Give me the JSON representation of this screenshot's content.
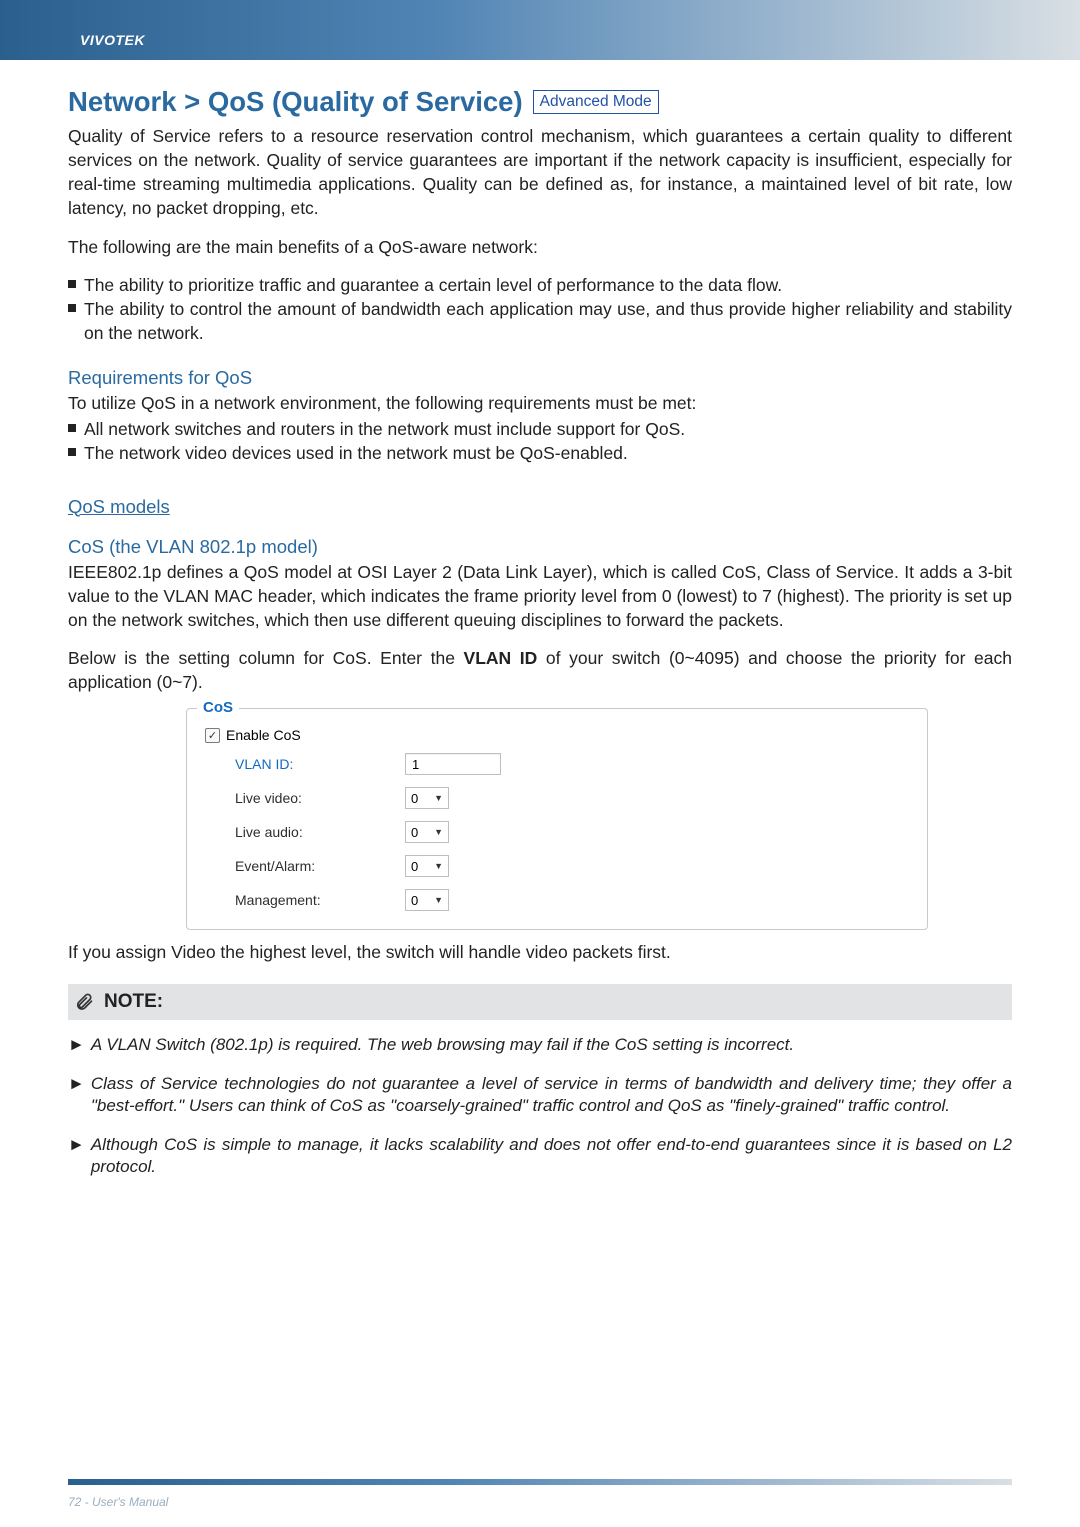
{
  "brand": "VIVOTEK",
  "title": "Network > QoS (Quality of Service)",
  "mode_badge": "Advanced Mode",
  "intro1": "Quality of Service refers to a resource reservation control mechanism, which guarantees a certain quality to different services on the network. Quality of service guarantees are important if the network capacity is insufficient, especially for real-time streaming multimedia applications. Quality can be defined as, for instance, a maintained level of bit rate, low latency, no packet dropping, etc.",
  "benefits_intro": "The following are the main benefits of a QoS-aware network:",
  "benefits": [
    "The ability to prioritize traffic and guarantee a certain level of performance to the data flow.",
    "The ability to control the amount of bandwidth each application may use, and thus provide higher reliability and stability on the network."
  ],
  "req_heading": "Requirements for QoS",
  "req_intro": "To utilize QoS in a network environment, the following requirements must be met:",
  "req_items": [
    "All network switches and routers in the network must include support for QoS.",
    "The network video devices used in the network must be QoS-enabled."
  ],
  "qos_models_heading": "QoS models",
  "cos_heading": "CoS (the VLAN 802.1p model)",
  "cos_para": "IEEE802.1p defines a QoS model at OSI Layer 2 (Data Link Layer), which is called CoS, Class of Service. It adds a 3-bit value to the VLAN MAC header, which indicates the frame priority level from 0 (lowest) to 7 (highest). The priority is set up on the network switches, which then use different queuing disciplines to forward the packets.",
  "cos_below_pre": "Below is the setting column for CoS. Enter the ",
  "cos_below_bold": "VLAN ID",
  "cos_below_post": " of your switch (0~4095) and choose the priority for each application (0~7).",
  "fieldset": {
    "legend": "CoS",
    "enable_label": "Enable CoS",
    "checkbox_checked": "✓",
    "rows": [
      {
        "label": "VLAN ID:",
        "value": "1",
        "type": "text",
        "labelColor": "blue"
      },
      {
        "label": "Live video:",
        "value": "0",
        "type": "select"
      },
      {
        "label": "Live audio:",
        "value": "0",
        "type": "select"
      },
      {
        "label": "Event/Alarm:",
        "value": "0",
        "type": "select"
      },
      {
        "label": "Management:",
        "value": "0",
        "type": "select"
      }
    ]
  },
  "after_fieldset": "If you assign Video the highest level, the switch will handle video packets first.",
  "note_label": "NOTE:",
  "notes": [
    "A VLAN Switch (802.1p) is required. The web browsing may fail if the CoS setting is incorrect.",
    "Class of Service technologies do not guarantee a level of service in terms of bandwidth and delivery time; they offer a \"best-effort.\" Users can think of CoS as \"coarsely-grained\" traffic control and QoS as \"finely-grained\" traffic control.",
    "Although CoS is simple to manage, it lacks scalability and does not offer end-to-end guarantees since it is based on L2 protocol."
  ],
  "footer": "72 - User's Manual"
}
